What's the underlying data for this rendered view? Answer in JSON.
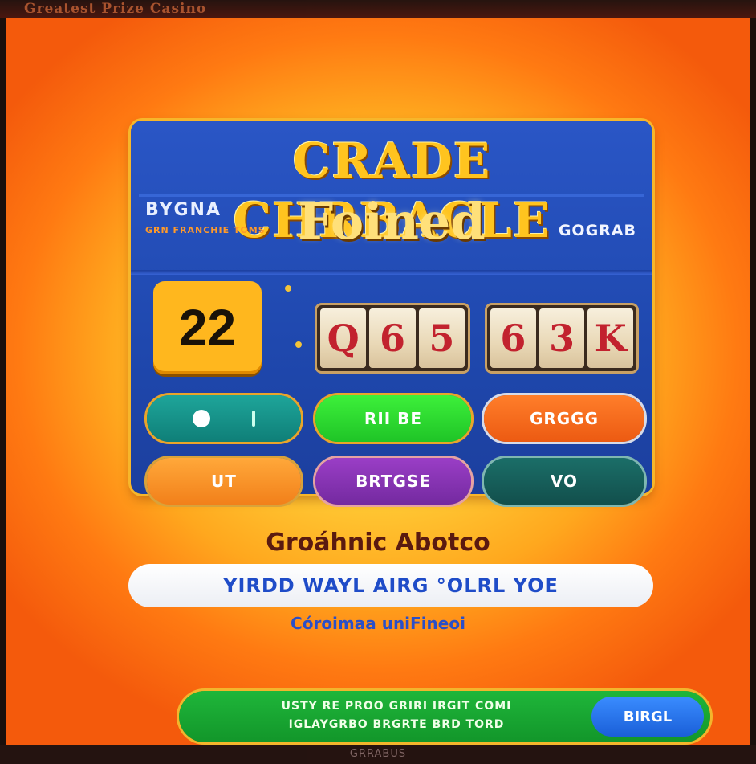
{
  "top_band": "Greatest Prize Casino",
  "game": {
    "title": "CRADE CHRBACLE",
    "subtitle": "Foined",
    "left_label": "BYGNA",
    "left_sub_label": "GRN FRANCHIE TOMS",
    "right_label": "GOGRAB",
    "level": "22",
    "reels_group_1": [
      "Q",
      "6",
      "5"
    ],
    "reels_group_2": [
      "6",
      "3",
      "K"
    ]
  },
  "buttons": {
    "row1": [
      "",
      "RII BE",
      "GRGGG"
    ],
    "row2": [
      "UT",
      "BRTGSE",
      "VO"
    ]
  },
  "lower": {
    "caption": "Groáhnic Abotco",
    "info_bar": "YIRDD WAYL AIRG °OLRL YOE",
    "note": "Córoimaa uniFineoi"
  },
  "footer": {
    "text_line1": "USTY RE  PROO GRIRI IRGIT COMI",
    "text_line2": "IGLAYGRBO BRGRTE BRD TORD",
    "cta": "BIRGL"
  },
  "bottom_band": "GRRABUS",
  "colors": {
    "panel_blue": "#2a56c6",
    "title_gold": "#ffc41f",
    "reel_red": "#c2222e",
    "background_orange": "#ff9a1e"
  }
}
